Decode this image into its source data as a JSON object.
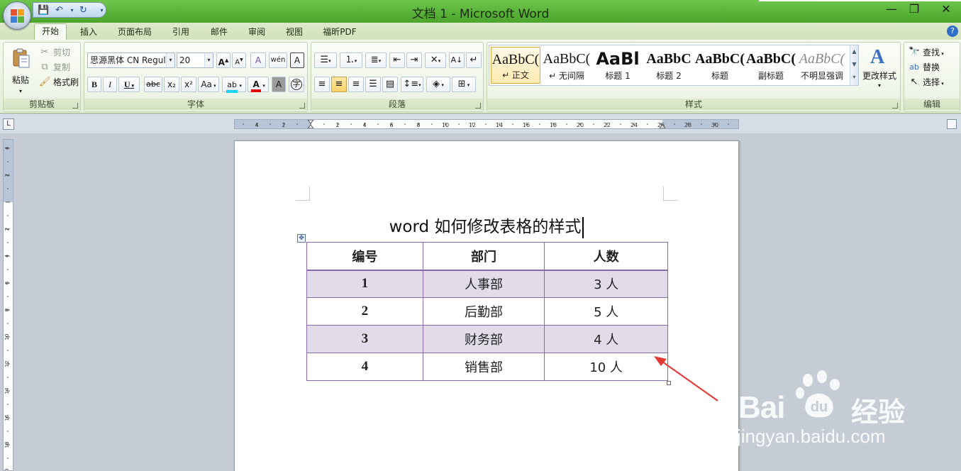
{
  "window": {
    "title": "文档 1 - Microsoft Word",
    "controls": {
      "minimize": "—",
      "maximize": "❐",
      "close": "✕"
    }
  },
  "tabs": [
    {
      "label": "开始",
      "active": true
    },
    {
      "label": "插入"
    },
    {
      "label": "页面布局"
    },
    {
      "label": "引用"
    },
    {
      "label": "邮件"
    },
    {
      "label": "审阅"
    },
    {
      "label": "视图"
    },
    {
      "label": "福昕PDF"
    }
  ],
  "ribbon": {
    "clipboard": {
      "label": "剪贴板",
      "paste": "粘贴",
      "cut": "剪切",
      "copy": "复制",
      "format_painter": "格式刷"
    },
    "font": {
      "label": "字体",
      "font_name": "思源黑体 CN Regul",
      "font_size": "20",
      "bold": "B",
      "italic": "I",
      "underline": "U",
      "strike": "abc",
      "subscript": "x₂",
      "superscript": "x²",
      "change_case": "Aa",
      "grow": "A",
      "shrink": "A",
      "clear": "A",
      "phonetic": "wén",
      "border_char": "A",
      "shade_char": "A",
      "enclose": "字"
    },
    "paragraph": {
      "label": "段落"
    },
    "styles": {
      "label": "样式",
      "items": [
        {
          "sample": "AaBbC(",
          "name": "↵ 正文",
          "selected": true
        },
        {
          "sample": "AaBbC(",
          "name": "↵ 无间隔"
        },
        {
          "sample": "AaBl",
          "name": "标题 1"
        },
        {
          "sample": "AaBbC",
          "name": "标题 2"
        },
        {
          "sample": "AaBbC(",
          "name": "标题"
        },
        {
          "sample": "AaBbC(",
          "name": "副标题"
        },
        {
          "sample": "AaBbC(",
          "name": "不明显强调"
        }
      ],
      "change_styles": "更改样式"
    },
    "editing": {
      "label": "编辑",
      "find": "查找",
      "replace": "替换",
      "select": "选择"
    }
  },
  "ruler": {
    "left_numbers": [
      "4",
      "2"
    ],
    "numbers": [
      "2",
      "4",
      "6",
      "8",
      "10",
      "12",
      "14",
      "16",
      "18",
      "20",
      "22",
      "24",
      "26",
      "28",
      "30"
    ],
    "vertical_numbers": [
      "4",
      "2",
      "2",
      "4",
      "6",
      "8",
      "10",
      "12",
      "14",
      "16",
      "18",
      "20"
    ]
  },
  "document": {
    "title": "word 如何修改表格的样式",
    "table": {
      "headers": [
        "编号",
        "部门",
        "人数"
      ],
      "rows": [
        [
          "1",
          "人事部",
          "3 人"
        ],
        [
          "2",
          "后勤部",
          "5 人"
        ],
        [
          "3",
          "财务部",
          "4 人"
        ],
        [
          "4",
          "销售部",
          "10 人"
        ]
      ]
    }
  },
  "watermark": {
    "brand": "Bai",
    "paw": "du",
    "product": "经验",
    "url": "jingyan.baidu.com"
  },
  "colors": {
    "title_bar": "#59b338",
    "table_border": "#8a6aa3",
    "band_fill": "#e2dcea",
    "annotation_arrow": "#e53935"
  }
}
